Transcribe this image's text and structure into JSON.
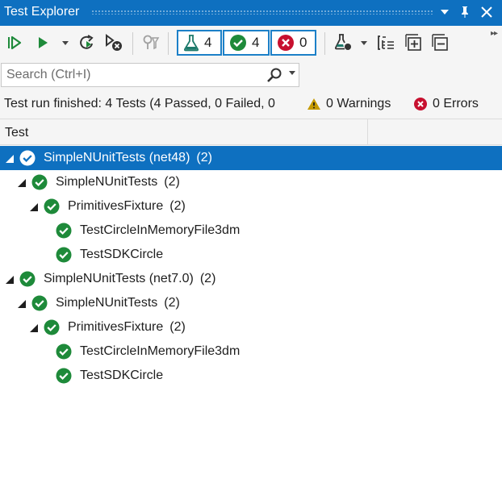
{
  "window": {
    "title": "Test Explorer"
  },
  "toolbar": {
    "counters": {
      "total": "4",
      "passed": "4",
      "failed": "0"
    }
  },
  "search": {
    "placeholder": "Search (Ctrl+I)"
  },
  "status": {
    "summary": "Test run finished: 4 Tests (4 Passed, 0 Failed, 0",
    "warnings": "0 Warnings",
    "errors": "0 Errors"
  },
  "columns": {
    "test": "Test"
  },
  "tree": [
    {
      "label": "SimpleNUnitTests (net48)",
      "count": "(2)",
      "level": 0,
      "expanded": true,
      "selected": true
    },
    {
      "label": "SimpleNUnitTests",
      "count": "(2)",
      "level": 1,
      "expanded": true
    },
    {
      "label": "PrimitivesFixture",
      "count": "(2)",
      "level": 2,
      "expanded": true
    },
    {
      "label": "TestCircleInMemoryFile3dm",
      "count": "",
      "level": 3,
      "expanded": false
    },
    {
      "label": "TestSDKCircle",
      "count": "",
      "level": 3,
      "expanded": false
    },
    {
      "label": "SimpleNUnitTests (net7.0)",
      "count": "(2)",
      "level": 0,
      "expanded": true
    },
    {
      "label": "SimpleNUnitTests",
      "count": "(2)",
      "level": 1,
      "expanded": true
    },
    {
      "label": "PrimitivesFixture",
      "count": "(2)",
      "level": 2,
      "expanded": true
    },
    {
      "label": "TestCircleInMemoryFile3dm",
      "count": "",
      "level": 3,
      "expanded": false
    },
    {
      "label": "TestSDKCircle",
      "count": "",
      "level": 3,
      "expanded": false
    }
  ],
  "colors": {
    "title_bar": "#0e70c0",
    "selection": "#0e70c0",
    "passed_green": "#1e8a3a",
    "failed_red": "#c7102f",
    "warning_yellow": "#c59a00"
  }
}
